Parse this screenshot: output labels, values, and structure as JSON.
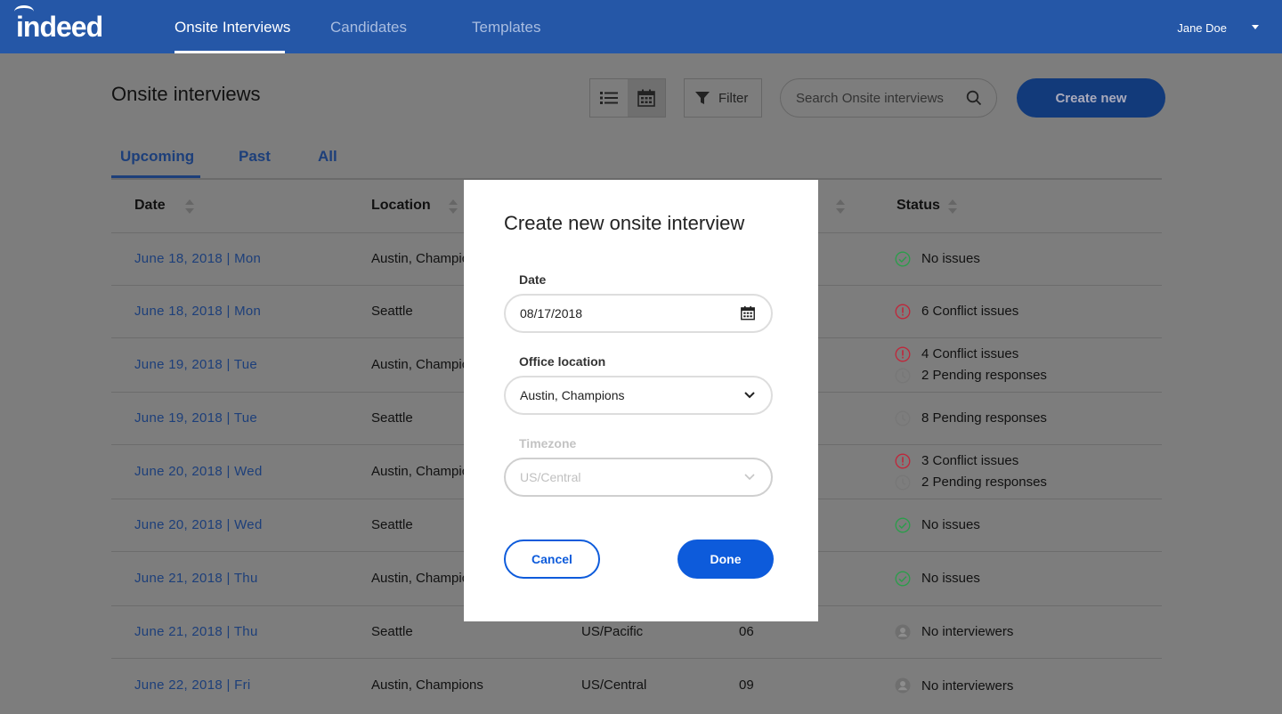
{
  "colors": {
    "brand": "#2557a7",
    "accent": "#0d5bdb",
    "ok": "#2a9d4a",
    "conflict": "#c0263a",
    "pending": "#777777"
  },
  "header": {
    "logo": "indeed",
    "tabs": [
      {
        "label": "Onsite Interviews",
        "active": true
      },
      {
        "label": "Candidates",
        "active": false
      },
      {
        "label": "Templates",
        "active": false
      }
    ],
    "user": "Jane Doe"
  },
  "page": {
    "title": "Onsite interviews",
    "filter_label": "Filter",
    "search_placeholder": "Search Onsite interviews",
    "create_label": "Create new",
    "view_icons": [
      "list-icon",
      "calendar-icon"
    ],
    "tabs": [
      "Upcoming",
      "Past",
      "All"
    ],
    "active_tab": "Upcoming"
  },
  "table": {
    "columns": [
      "Date",
      "Location",
      "Status"
    ],
    "rows": [
      {
        "date": "June 18, 2018  |  Mon",
        "location": "Austin, Champic",
        "timezone": "",
        "count": "",
        "status": [
          {
            "icon": "check-icon",
            "text": "No issues"
          }
        ]
      },
      {
        "date": "June 18, 2018  |  Mon",
        "location": "Seattle",
        "timezone": "",
        "count": "",
        "status": [
          {
            "icon": "alert-icon",
            "text": "6 Conflict issues"
          }
        ]
      },
      {
        "date": "June 19, 2018  |  Tue",
        "location": "Austin, Champic",
        "timezone": "",
        "count": "",
        "status": [
          {
            "icon": "alert-icon",
            "text": "4 Conflict issues"
          },
          {
            "icon": "clock-icon",
            "text": "2 Pending responses"
          }
        ]
      },
      {
        "date": "June 19, 2018  |  Tue",
        "location": "Seattle",
        "timezone": "",
        "count": "",
        "status": [
          {
            "icon": "clock-icon",
            "text": "8 Pending responses"
          }
        ]
      },
      {
        "date": "June 20, 2018  |  Wed",
        "location": "Austin, Champic",
        "timezone": "",
        "count": "",
        "status": [
          {
            "icon": "alert-icon",
            "text": "3 Conflict issues"
          },
          {
            "icon": "clock-icon",
            "text": "2 Pending responses"
          }
        ]
      },
      {
        "date": "June 20, 2018  |  Wed",
        "location": "Seattle",
        "timezone": "",
        "count": "",
        "status": [
          {
            "icon": "check-icon",
            "text": "No issues"
          }
        ]
      },
      {
        "date": "June 21, 2018  |  Thu",
        "location": "Austin, Champic",
        "timezone": "",
        "count": "",
        "status": [
          {
            "icon": "check-icon",
            "text": "No issues"
          }
        ]
      },
      {
        "date": "June 21, 2018  |  Thu",
        "location": "Seattle",
        "timezone": "US/Pacific",
        "count": "06",
        "status": [
          {
            "icon": "person-icon",
            "text": "No interviewers"
          }
        ]
      },
      {
        "date": "June 22, 2018  |  Fri",
        "location": "Austin, Champions",
        "timezone": "US/Central",
        "count": "09",
        "status": [
          {
            "icon": "person-icon",
            "text": "No interviewers"
          }
        ]
      }
    ]
  },
  "modal": {
    "title": "Create new onsite interview",
    "date_label": "Date",
    "date_value": "08/17/2018",
    "location_label": "Office location",
    "location_value": "Austin, Champions",
    "timezone_label": "Timezone",
    "timezone_value": "US/Central",
    "cancel_label": "Cancel",
    "done_label": "Done"
  }
}
